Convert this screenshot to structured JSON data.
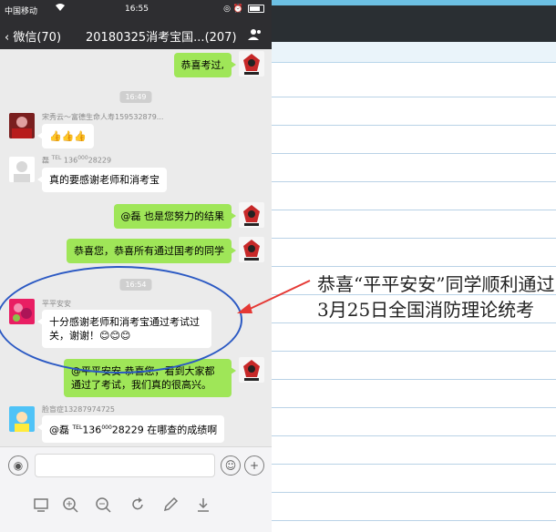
{
  "status_bar": {
    "carrier": "中国移动",
    "time": "16:55",
    "battery_icon": "battery-icon"
  },
  "nav": {
    "back_label": "微信(70)",
    "title": "20180325消考宝国...(207)"
  },
  "messages": {
    "m1": "恭喜考过,",
    "t1": "16:49",
    "m2_sender": "宋秀云～富德生命人寿159532879...",
    "m2_text": "👍👍👍",
    "m3_sender_name": "磊",
    "m3_sender_tel": "TEL",
    "m3_sender_num1": "136",
    "m3_sender_num2": "000",
    "m3_sender_num3": "28229",
    "m3_text": "真的要感谢老师和消考宝",
    "m4": "@磊 也是您努力的结果",
    "m5": "恭喜您，恭喜所有通过国考的同学",
    "t2": "16:54",
    "m6_sender": "平平安安",
    "m6_text": "十分感谢老师和消考宝通过考试过关，谢谢！😊😊😊",
    "m7": "@平平安安 恭喜您，看到大家都通过了考试，我们真的很高兴。",
    "m8_sender": "脸盲症13287974725",
    "m8_prefix": "@磊",
    "m8_tel": "TEL",
    "m8_num1": "136",
    "m8_num2": "000",
    "m8_num3": "28229",
    "m8_suffix": "在哪查的成绩啊"
  },
  "annotation": "恭喜“平平安安”同学顺利通过3月25日全国消防理论统考",
  "colors": {
    "sent_bubble": "#9fe658",
    "received_bubble": "#ffffff",
    "navbar": "#2e2e31",
    "annotation_circle": "#2b59c3",
    "arrow": "#e53935"
  }
}
